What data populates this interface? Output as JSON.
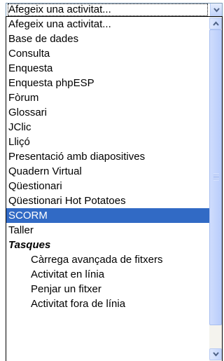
{
  "closed_select": {
    "value": "Afegeix una activitat..."
  },
  "dropdown": {
    "options": [
      {
        "label": "Afegeix una activitat...",
        "kind": "option"
      },
      {
        "label": "Base de dades",
        "kind": "option"
      },
      {
        "label": "Consulta",
        "kind": "option"
      },
      {
        "label": "Enquesta",
        "kind": "option"
      },
      {
        "label": "Enquesta phpESP",
        "kind": "option"
      },
      {
        "label": "Fòrum",
        "kind": "option"
      },
      {
        "label": "Glossari",
        "kind": "option"
      },
      {
        "label": "JClic",
        "kind": "option"
      },
      {
        "label": "Lliçó",
        "kind": "option"
      },
      {
        "label": "Presentació amb diapositives",
        "kind": "option"
      },
      {
        "label": "Quadern Virtual",
        "kind": "option"
      },
      {
        "label": "Qüestionari",
        "kind": "option"
      },
      {
        "label": "Qüestionari Hot Potatoes",
        "kind": "option"
      },
      {
        "label": "SCORM",
        "kind": "option",
        "selected": true
      },
      {
        "label": "Taller",
        "kind": "option"
      },
      {
        "label": "Tasques",
        "kind": "group"
      },
      {
        "label": "Càrrega avançada de fitxers",
        "kind": "sub"
      },
      {
        "label": "Activitat en línia",
        "kind": "sub"
      },
      {
        "label": "Penjar un fitxer",
        "kind": "sub"
      },
      {
        "label": "Activitat fora de línia",
        "kind": "sub"
      }
    ]
  },
  "colors": {
    "selection": "#316ac5",
    "scrollbar": "#c1d3fb"
  }
}
